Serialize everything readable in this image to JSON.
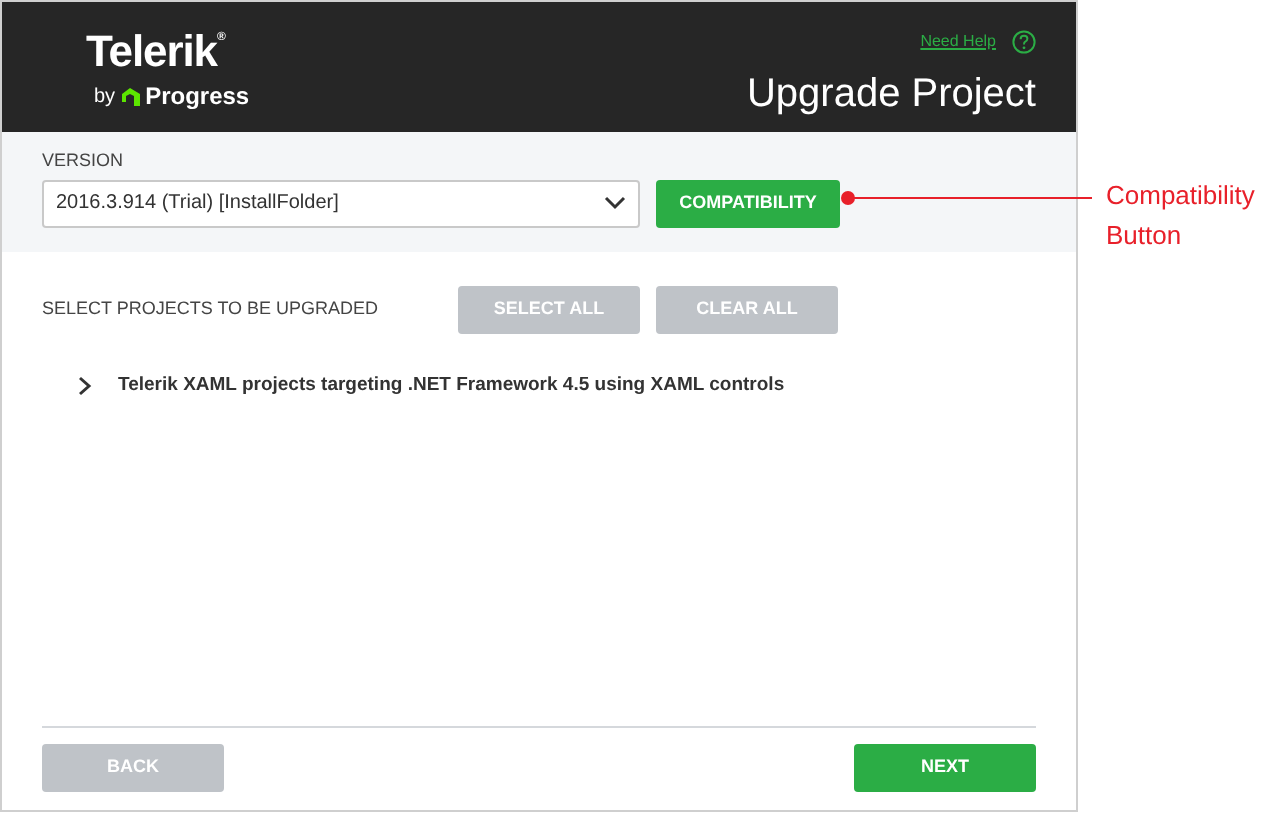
{
  "header": {
    "logo": {
      "name": "Telerik$^{®}$",
      "by": "by",
      "company": "Progress"
    },
    "help_link": "Need Help",
    "title": "Upgrade Project"
  },
  "version": {
    "label": "VERSION",
    "value": "2016.3.914 (Trial) [InstallFolder]",
    "compatibility_button": {
      "label": "COMPATIBILITY",
      "disabled": false
    }
  },
  "projects": {
    "label": "SELECT PROJECTS TO BE UPGRADED",
    "buttons": [
      {
        "label": "SELECT ALL",
        "disabled": true
      },
      {
        "label": "CLEAR ALL",
        "disabled": true
      }
    ],
    "groups": [
      {
        "label": "Telerik XAML projects targeting .NET Framework 4.5 using XAML controls",
        "expanded": false
      }
    ]
  },
  "footer": {
    "buttons": [
      {
        "label": "BACK",
        "disabled": true
      },
      {
        "label": "NEXT",
        "disabled": false
      }
    ]
  },
  "annotation": {
    "lines": [
      "Compatibility",
      "Button"
    ]
  }
}
